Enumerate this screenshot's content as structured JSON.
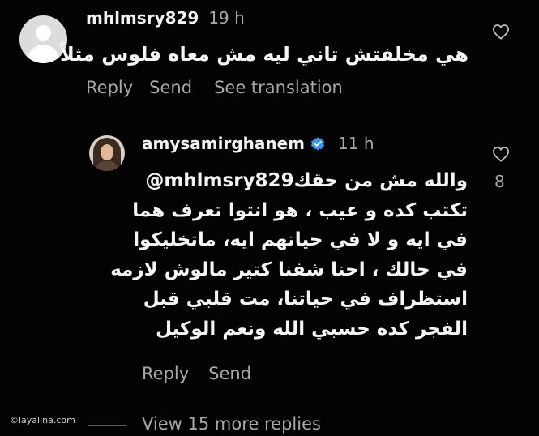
{
  "colors": {
    "background": "#030303",
    "primary_text": "#f2f2f2",
    "secondary_text": "#a8a8a8",
    "verified_badge": "#3897f0"
  },
  "comments": [
    {
      "username": "mhlmsry829",
      "time": "19 h",
      "avatar": "default-avatar-icon",
      "text_lines": [
        "هي مخلفتش تاني ليه مش معاه فلوس مثلاً"
      ],
      "actions": {
        "reply": "Reply",
        "send": "Send",
        "translation": "See translation"
      },
      "like_icon": "heart-outline-icon"
    },
    {
      "username": "amysamirghanem",
      "verified": true,
      "verified_icon": "verified-badge-icon",
      "time": "11 h",
      "like_icon": "heart-outline-icon",
      "like_count": "8",
      "mention": "@mhlmsry829",
      "text_lines": [
        "والله مش من حقك",
        "تكتب كده و عيب ، هو انتوا تعرف هما",
        "في ايه و لا في حياتهم ايه، ماتخليكوا",
        "في حالك ، احنا شفنا كتير مالوش لازمه",
        "استظراف في حياتنا، مت قلبي قبل",
        "الفجر كده حسبي الله ونعم الوكيل"
      ],
      "actions": {
        "reply": "Reply",
        "send": "Send"
      }
    }
  ],
  "footer": {
    "view_more": "View 15 more replies",
    "watermark": "©layalina.com"
  }
}
